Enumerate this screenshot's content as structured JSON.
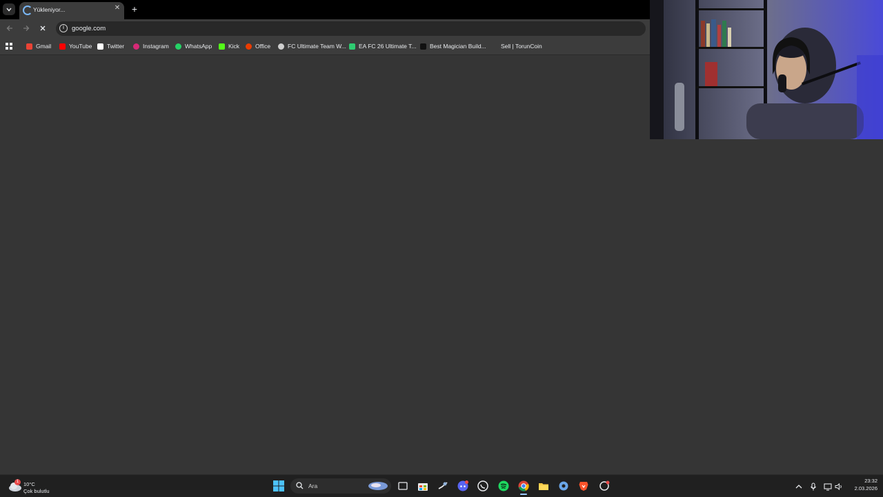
{
  "browser": {
    "tab": {
      "title": "Yükleniyor...",
      "close": "✕"
    },
    "new_tab": "+",
    "address": "google.com",
    "bookmarks": [
      {
        "label": "Gmail",
        "icon": "gmail-icon",
        "color": "#ea4335"
      },
      {
        "label": "YouTube",
        "icon": "youtube-icon",
        "color": "#ff0000"
      },
      {
        "label": "Twitter",
        "icon": "x-icon",
        "color": "#ffffff"
      },
      {
        "label": "Instagram",
        "icon": "instagram-icon",
        "color": "#d62976"
      },
      {
        "label": "WhatsApp",
        "icon": "whatsapp-icon",
        "color": "#25d366"
      },
      {
        "label": "Kick",
        "icon": "kick-icon",
        "color": "#53fc18"
      },
      {
        "label": "Office",
        "icon": "office-icon",
        "color": "#eb3c00"
      },
      {
        "label": "FC Ultimate Team W...",
        "icon": "globe-icon",
        "color": "#cfcfcf"
      },
      {
        "label": "EA FC 26 Ultimate T...",
        "icon": "futbin-icon",
        "color": "#2ecc71"
      },
      {
        "label": "Best Magician Build...",
        "icon": "site-icon",
        "color": "#111111"
      },
      {
        "label": "Sell | TorunCoin",
        "icon": "blank-icon",
        "color": "#3c3c3c"
      }
    ]
  },
  "taskbar": {
    "weather": {
      "temp": "10°C",
      "condition": "Çok bulutlu",
      "badge": "1"
    },
    "search_label": "Ara",
    "clock": {
      "time": "23:32",
      "date": "2.03.2026"
    }
  }
}
